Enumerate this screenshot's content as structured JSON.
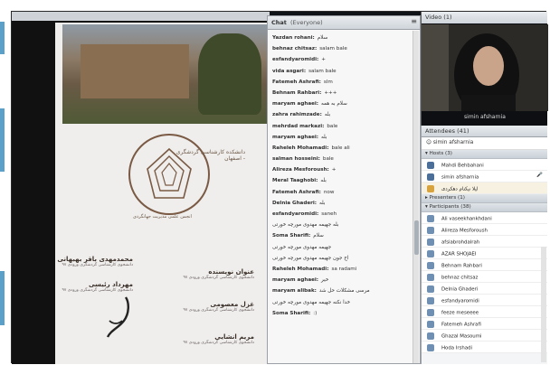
{
  "chat": {
    "title": "Chat",
    "scope": "(Everyone)",
    "messages": [
      {
        "sender": "Yazdan rohani:",
        "text": "سلام"
      },
      {
        "sender": "behnaz chitsaz:",
        "text": "salam bale"
      },
      {
        "sender": "esfandyaromidi:",
        "text": "+"
      },
      {
        "sender": "vida asgari:",
        "text": "salam bale"
      },
      {
        "sender": "Fatemeh Ashrafi:",
        "text": "slm"
      },
      {
        "sender": "Behnam Rahbari:",
        "text": "+++"
      },
      {
        "sender": "maryam aghaei:",
        "text": "سلام به همه"
      },
      {
        "sender": "zahra rahimzade:",
        "text": "بله"
      },
      {
        "sender": "mehrdad markazi:",
        "text": "bale"
      },
      {
        "sender": "maryam aghaei:",
        "text": "بله"
      },
      {
        "sender": "Raheleh Mohamadi:",
        "text": "bale ali"
      },
      {
        "sender": "salman hosseini:",
        "text": "bale"
      },
      {
        "sender": "Alireza Mesforoush:",
        "text": "+"
      },
      {
        "sender": "Meral Taaghobi:",
        "text": "بله"
      },
      {
        "sender": "Fatemeh Ashrafi:",
        "text": "now"
      },
      {
        "sender": "Delnia Ghaderi:",
        "text": "بله"
      },
      {
        "sender": "esfandyaromidi:",
        "text": "saneh"
      },
      {
        "sender": "",
        "text": "بله جهیمه مهدوی مورچه خورتی"
      },
      {
        "sender": "Soma Sharifi:",
        "text": "سلام"
      },
      {
        "sender": "",
        "text": "جهیمه مهدوی مورچه خورتی"
      },
      {
        "sender": "",
        "text": "اخ جون جهیمه مهدوی مورچه خورتی"
      },
      {
        "sender": "Raheleh Mohamadi:",
        "text": "sa radami"
      },
      {
        "sender": "maryam aghaei:",
        "text": "خیر"
      },
      {
        "sender": "maryam alibak:",
        "text": "مرسی مشکلات حل شد"
      },
      {
        "sender": "",
        "text": "خدا نکنه جهیمه مهدوی مورچه خورتی"
      },
      {
        "sender": "Soma Sharifi:",
        "text": ":)"
      }
    ]
  },
  "video": {
    "title": "Video",
    "count": "(1)",
    "speaker": "simin afsharnia"
  },
  "attendees": {
    "title": "Attendees",
    "count": "(41)",
    "current_host": "simin afsharnia",
    "groups": {
      "hosts": "Hosts (3)",
      "presenters": "Presenters (1)",
      "participants": "Participants (38)"
    },
    "hosts": [
      "Mahdi Behbahani",
      "simin afsharnia",
      "لیلا نیکنام دهکردی"
    ],
    "participants": [
      "Ali vaseekhankhdani",
      "Alireza Mesforoush",
      "afsiabrohdalrah",
      "AZAR SHOJAEI",
      "Behnam Rahbari",
      "behnaz chitsaz",
      "Delnia Ghaderi",
      "esfandyaromidi",
      "feeze meseeee",
      "Fatemeh Ashrafi",
      "Ghazal Masoumi",
      "Hoda Irshadi"
    ]
  },
  "slide": {
    "logo_text": "دانشکده کارشناسی گردشگری - اصفهان",
    "emblem_caption": "انجمن علمی مدیریت جهانگردی",
    "people": [
      {
        "name": "محمدمهدی باقر بهبهانی",
        "role": "دانشجوی کارشناسی گردشگری ورودی ۹۷"
      },
      {
        "name": "عنوان نویسنده",
        "role": "دانشجوی کارشناسی گردشگری ورودی ۹۷"
      },
      {
        "name": "مهرداد رئیسی",
        "role": "دانشجوی کارشناسی گردشگری ورودی ۹۷"
      },
      {
        "name": "غزل معصومی",
        "role": "دانشجوی کارشناسی گردشگری ورودی ۹۷"
      },
      {
        "name": "مریم انشایی",
        "role": "دانشجوی کارشناسی گردشگری ورودی ۹۷"
      }
    ]
  },
  "colors": {
    "accent": "#5aa0c8",
    "emblem": "#7a5a44"
  }
}
